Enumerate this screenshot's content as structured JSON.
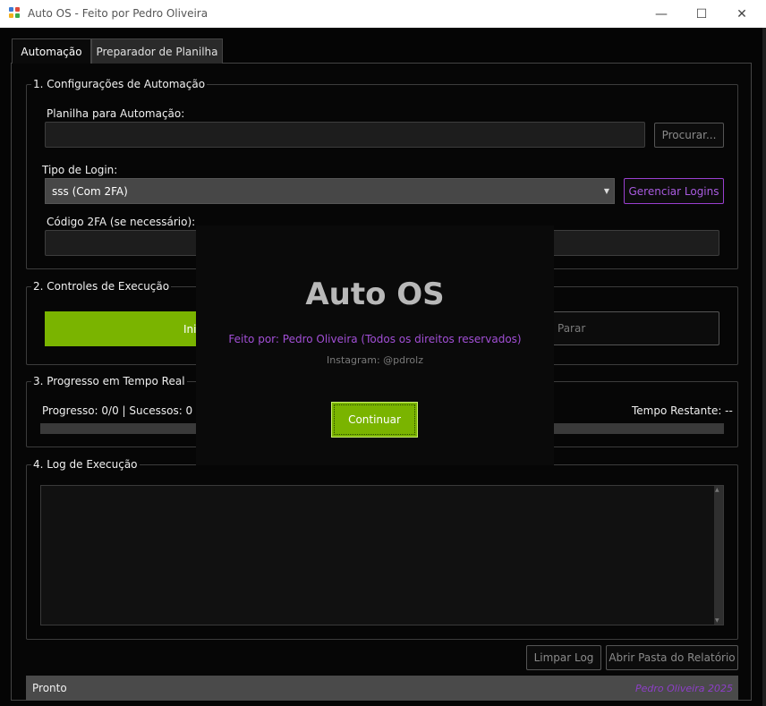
{
  "window": {
    "title": "Auto OS - Feito por Pedro Oliveira",
    "controls": {
      "minimize": "—",
      "maximize": "☐",
      "close": "✕"
    }
  },
  "tabs": [
    {
      "label": "Automação",
      "active": true
    },
    {
      "label": "Preparador de Planilha",
      "active": false
    }
  ],
  "config": {
    "title": "1. Configurações de Automação",
    "sheet_label": "Planilha para Automação:",
    "sheet_value": "",
    "browse_button": "Procurar...",
    "login_type_label": "Tipo de Login:",
    "login_type_value": "sss (Com 2FA)",
    "manage_logins_button": "Gerenciar Logins",
    "twofa_label": "Código 2FA (se necessário):",
    "twofa_value": ""
  },
  "controls": {
    "title": "2. Controles de Execução",
    "start_button_partial": "Ini",
    "stop_button": "Parar"
  },
  "progress": {
    "title": "3. Progresso em Tempo Real",
    "status_text_partial": "Progresso: 0/0 | Sucessos: 0 | Erro",
    "time_remaining": "Tempo Restante: --",
    "fraction": 0
  },
  "log": {
    "title": "4. Log de Execução",
    "content": "",
    "clear_button": "Limpar Log",
    "open_report_button": "Abrir Pasta do Relatório"
  },
  "statusbar": {
    "status": "Pronto",
    "credit": "Pedro Oliveira 2025"
  },
  "splash": {
    "title": "Auto OS",
    "credit": "Feito por: Pedro Oliveira (Todos os direitos reservados)",
    "instagram": "Instagram: @pdrolz",
    "continue_button": "Continuar"
  },
  "colors": {
    "accent_green": "#7ab400",
    "accent_purple": "#a95be0",
    "background": "#050505"
  }
}
